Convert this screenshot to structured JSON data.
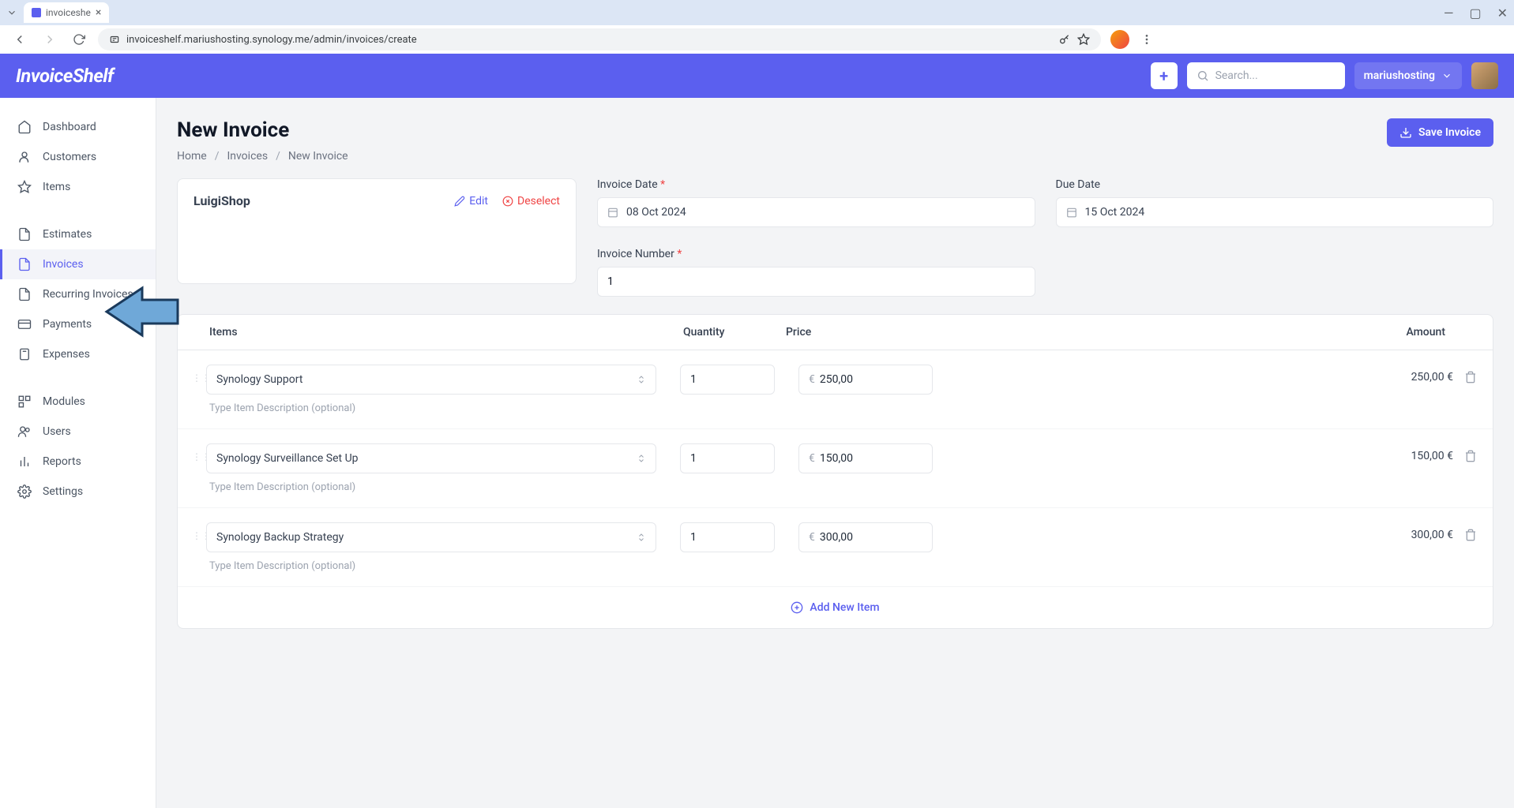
{
  "browser": {
    "tab_title": "invoiceshe",
    "url": "invoiceshelf.mariushosting.synology.me/admin/invoices/create"
  },
  "header": {
    "logo": "InvoiceShelf",
    "search_placeholder": "Search...",
    "user": "mariushosting"
  },
  "sidebar": {
    "items": [
      {
        "label": "Dashboard",
        "icon": "home"
      },
      {
        "label": "Customers",
        "icon": "user"
      },
      {
        "label": "Items",
        "icon": "star"
      }
    ],
    "items2": [
      {
        "label": "Estimates",
        "icon": "doc"
      },
      {
        "label": "Invoices",
        "icon": "doc",
        "active": true
      },
      {
        "label": "Recurring Invoices",
        "icon": "doc"
      },
      {
        "label": "Payments",
        "icon": "card"
      },
      {
        "label": "Expenses",
        "icon": "calc"
      }
    ],
    "items3": [
      {
        "label": "Modules",
        "icon": "puzzle"
      },
      {
        "label": "Users",
        "icon": "users"
      },
      {
        "label": "Reports",
        "icon": "chart"
      },
      {
        "label": "Settings",
        "icon": "gear"
      }
    ]
  },
  "page": {
    "title": "New Invoice",
    "breadcrumb": [
      "Home",
      "Invoices",
      "New Invoice"
    ],
    "save_label": "Save Invoice"
  },
  "customer": {
    "name": "LuigiShop",
    "edit": "Edit",
    "deselect": "Deselect"
  },
  "fields": {
    "invoice_date_label": "Invoice Date",
    "invoice_date": "08 Oct 2024",
    "due_date_label": "Due Date",
    "due_date": "15 Oct 2024",
    "invoice_number_label": "Invoice Number",
    "invoice_number": "1"
  },
  "table": {
    "headers": {
      "items": "Items",
      "qty": "Quantity",
      "price": "Price",
      "amount": "Amount"
    },
    "desc_placeholder": "Type Item Description (optional)",
    "currency": "€",
    "rows": [
      {
        "name": "Synology Support",
        "qty": "1",
        "price": "250,00",
        "amount": "250,00 €"
      },
      {
        "name": "Synology Surveillance Set Up",
        "qty": "1",
        "price": "150,00",
        "amount": "150,00 €"
      },
      {
        "name": "Synology Backup Strategy",
        "qty": "1",
        "price": "300,00",
        "amount": "300,00 €"
      }
    ],
    "add_item": "Add New Item"
  }
}
